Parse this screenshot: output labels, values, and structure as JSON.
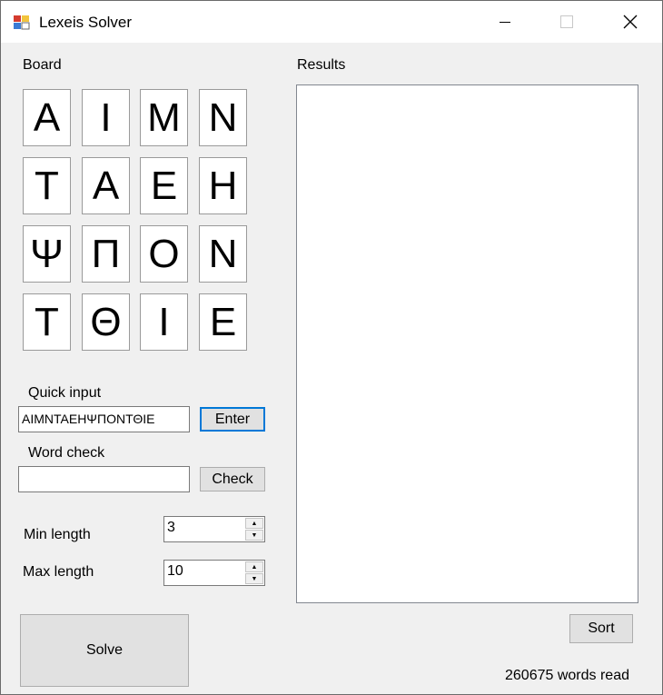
{
  "window": {
    "title": "Lexeis Solver",
    "icon": "app-icon",
    "controls": {
      "minimize": "minimize-icon",
      "maximize": "maximize-icon",
      "close": "close-icon"
    }
  },
  "board": {
    "label": "Board",
    "rows": [
      [
        "Α",
        "Ι",
        "Μ",
        "Ν"
      ],
      [
        "Τ",
        "Α",
        "Ε",
        "Η"
      ],
      [
        "Ψ",
        "Π",
        "Ο",
        "Ν"
      ],
      [
        "Τ",
        "Θ",
        "Ι",
        "Ε"
      ]
    ]
  },
  "quick_input": {
    "label": "Quick input",
    "value": "ΑΙΜΝΤΑΕΗΨΠΟΝΤΘΙΕ",
    "button": "Enter"
  },
  "word_check": {
    "label": "Word check",
    "value": "",
    "button": "Check"
  },
  "min_length": {
    "label": "Min length",
    "value": "3"
  },
  "max_length": {
    "label": "Max length",
    "value": "10"
  },
  "solve_button": "Solve",
  "results": {
    "label": "Results",
    "items": []
  },
  "sort_button": "Sort",
  "status": "260675 words read",
  "colors": {
    "focus_accent": "#0078d7",
    "background": "#f0f0f0"
  }
}
